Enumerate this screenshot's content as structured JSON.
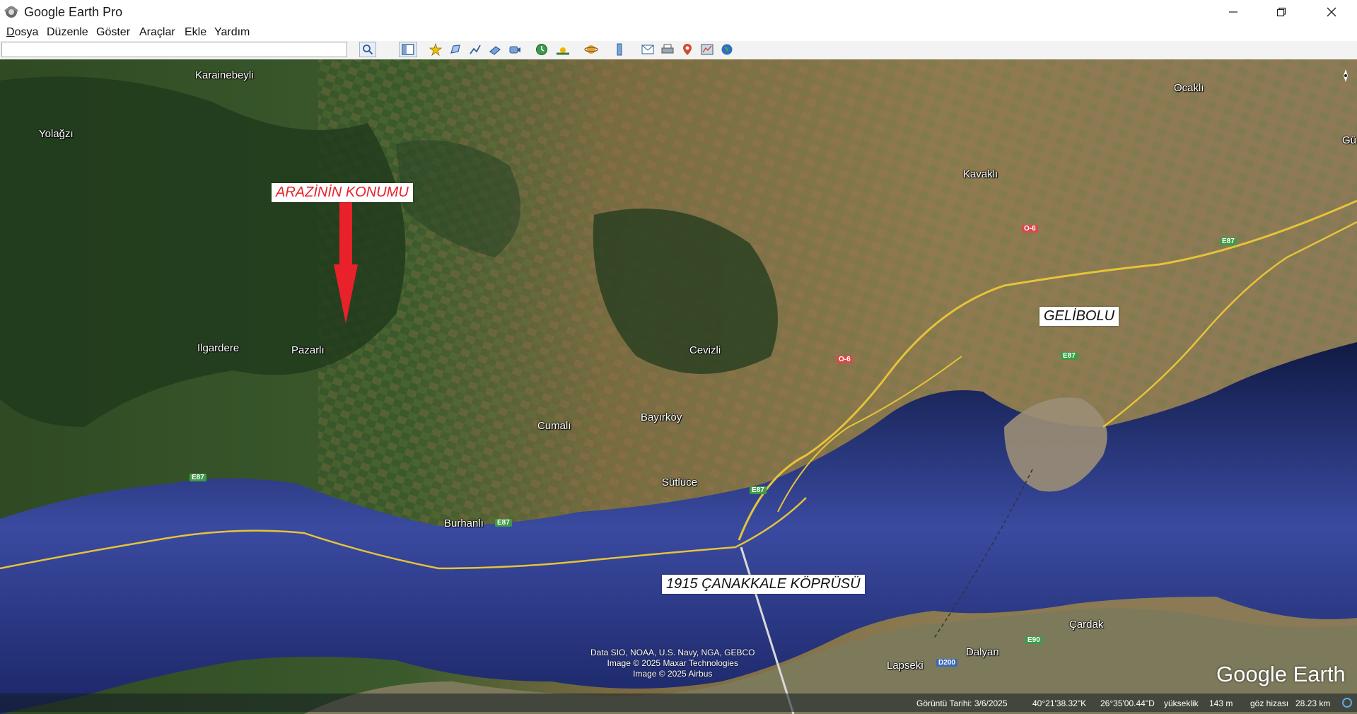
{
  "window": {
    "title": "Google Earth Pro",
    "controls": {
      "minimize": "minimize-icon",
      "restore": "restore-icon",
      "close": "close-icon"
    }
  },
  "menu": [
    "Dosya",
    "Düzenle",
    "Göster",
    "Araçlar",
    "Ekle",
    "Yardım"
  ],
  "menu_access_keys": [
    "D",
    "ü",
    "G",
    "A",
    "E",
    "Y"
  ],
  "search": {
    "value": "",
    "placeholder": ""
  },
  "toolbar_icons": [
    "search-icon",
    "sidebar-toggle-icon",
    "add-placemark-icon",
    "add-polygon-icon",
    "add-path-icon",
    "add-image-overlay-icon",
    "record-tour-icon",
    "historical-imagery-icon",
    "sunlight-icon",
    "planets-icon",
    "ruler-icon",
    "email-icon",
    "print-icon",
    "save-image-icon",
    "google-maps-icon",
    "earth-view-icon"
  ],
  "map": {
    "places": [
      {
        "name": "Karainebeyli"
      },
      {
        "name": "Yolağzı"
      },
      {
        "name": "Ilgardere"
      },
      {
        "name": "Pazarlı"
      },
      {
        "name": "Cevizli"
      },
      {
        "name": "Cumalı"
      },
      {
        "name": "Bayırköy"
      },
      {
        "name": "Sütlüce"
      },
      {
        "name": "Burhanlı"
      },
      {
        "name": "Kavaklı"
      },
      {
        "name": "Ocaklı"
      },
      {
        "name": "Gü"
      },
      {
        "name": "Çardak"
      },
      {
        "name": "Dalyan"
      },
      {
        "name": "Lapseki"
      }
    ],
    "callouts": {
      "parcel": "ARAZİNİN KONUMU",
      "city": "GELİBOLU",
      "bridge": "1915 ÇANAKKALE KÖPRÜSÜ"
    },
    "road_shields": [
      "E87",
      "E87",
      "E87",
      "E87",
      "E87",
      "O-6",
      "O-6",
      "E90",
      "D200"
    ],
    "attribution": [
      "Data SIO, NOAA, U.S. Navy, NGA, GEBCO",
      "Image © 2025 Maxar Technologies",
      "Image © 2025 Airbus"
    ],
    "logo": "Google Earth"
  },
  "status": {
    "imagery_date": "Görüntü Tarihi: 3/6/2025",
    "latitude": "40°21'38.32\"K",
    "longitude": "26°35'00.44\"D",
    "elevation_label": "yükseklik",
    "elevation_value": "143 m",
    "eye_alt_label": "göz hizası",
    "eye_alt_value": "28.23 km"
  },
  "colors": {
    "callout_red": "#e8212a",
    "road_yellow": "#e6c33a",
    "sea": "#2a3a86",
    "shield_green": "#3f9a48",
    "shield_red": "#d84a4a"
  }
}
